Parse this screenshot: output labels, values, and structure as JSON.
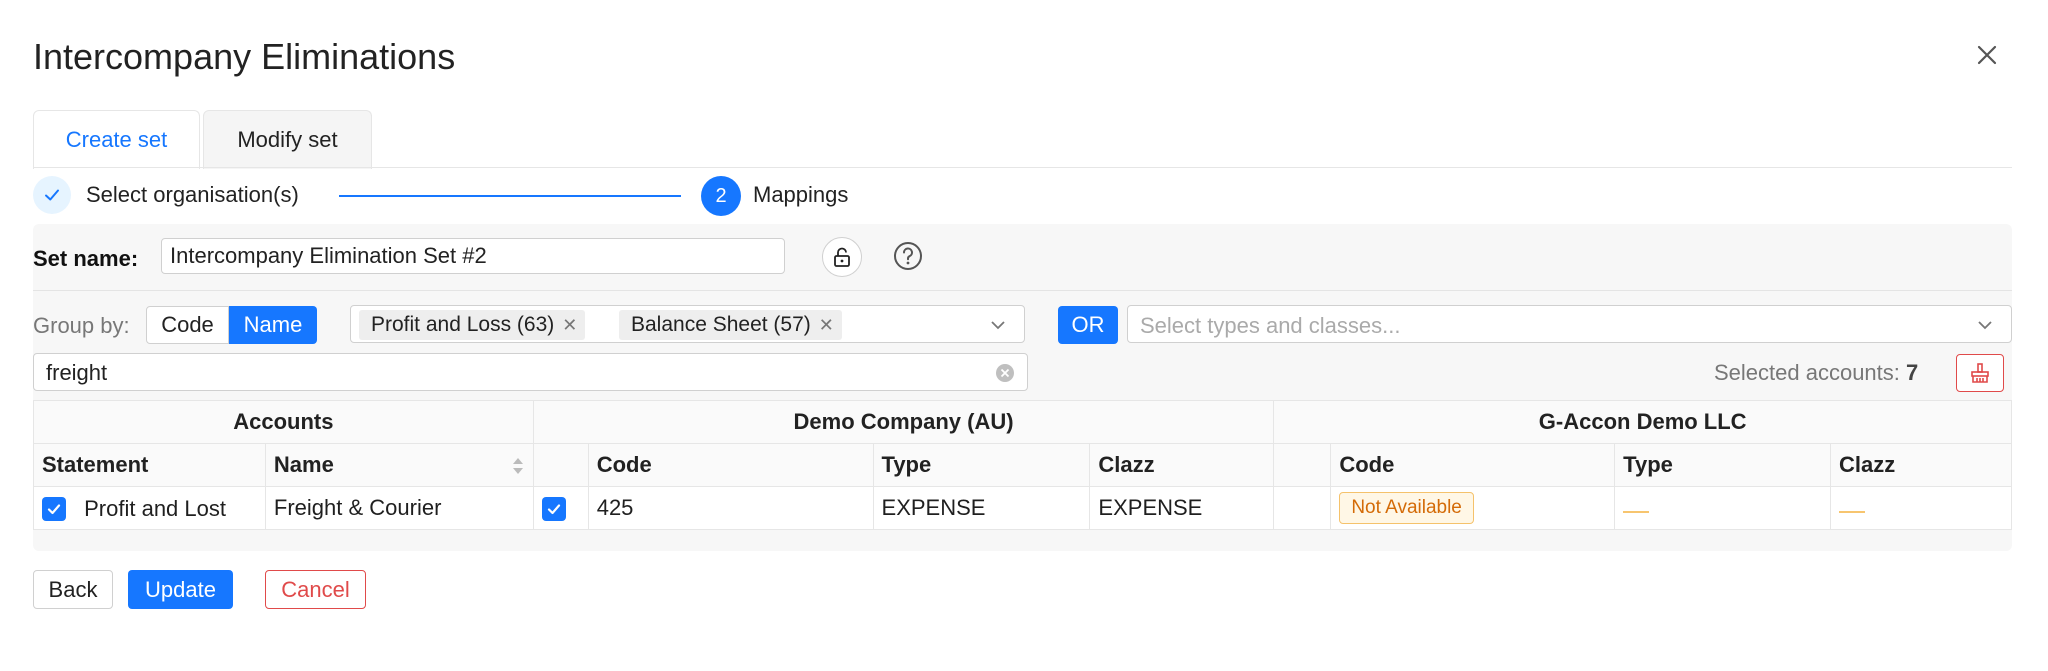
{
  "dialog": {
    "title": "Intercompany Eliminations"
  },
  "tabs": [
    {
      "label": "Create set"
    },
    {
      "label": "Modify set"
    }
  ],
  "steps": [
    {
      "label": "Select organisation(s)"
    },
    {
      "number": "2",
      "label": "Mappings"
    }
  ],
  "set": {
    "label": "Set name:",
    "value": "Intercompany Elimination Set #2"
  },
  "group_by": {
    "label": "Group by:",
    "options": [
      "Code",
      "Name"
    ],
    "selected": "Name"
  },
  "statement_filter": {
    "tags": [
      "Profit and Loss (63)",
      "Balance Sheet (57)"
    ]
  },
  "or_label": "OR",
  "types_select": {
    "placeholder": "Select types and classes..."
  },
  "search": {
    "value": "freight"
  },
  "selected_accounts": {
    "label": "Selected accounts:",
    "count": "7"
  },
  "table": {
    "groups": [
      "Accounts",
      "Demo Company (AU)",
      "G-Accon Demo LLC"
    ],
    "columns": [
      "Statement",
      "Name",
      "Code",
      "Type",
      "Clazz",
      "Code",
      "Type",
      "Clazz"
    ],
    "rows": [
      {
        "statement": "Profit and Lost",
        "name": "Freight & Courier",
        "demo_code": "425",
        "demo_type": "EXPENSE",
        "demo_clazz": "EXPENSE",
        "gaccon_code": "Not Available"
      }
    ]
  },
  "buttons": {
    "back": "Back",
    "update": "Update",
    "cancel": "Cancel"
  },
  "colors": {
    "primary": "#1677ff",
    "danger": "#e04a4a",
    "warning": "#d46b08"
  }
}
